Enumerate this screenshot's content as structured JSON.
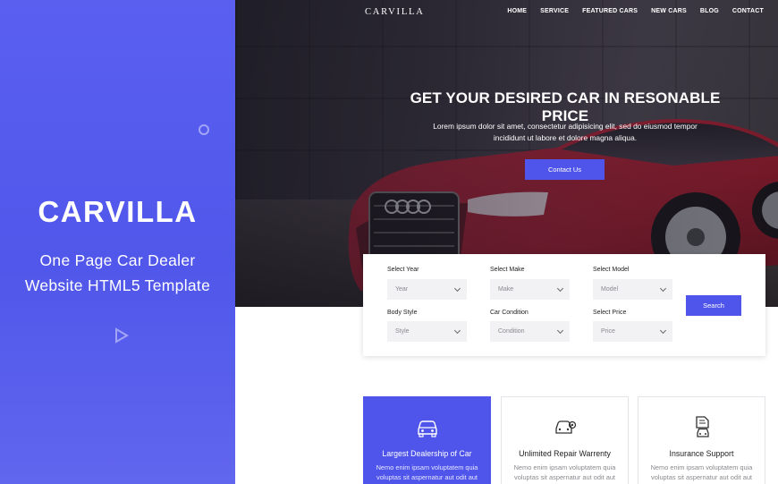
{
  "promo": {
    "title": "CARVILLA",
    "subtitle_line1": "One Page Car Dealer",
    "subtitle_line2": "Website HTML5 Template"
  },
  "nav": {
    "logo": "CARVILLA",
    "items": [
      "HOME",
      "SERVICE",
      "FEATURED CARS",
      "NEW CARS",
      "BLOG",
      "CONTACT"
    ]
  },
  "hero": {
    "headline": "GET YOUR DESIRED CAR IN RESONABLE PRICE",
    "lead_line1": "Lorem ipsum dolor sit amet, consectetur adipisicing elit, sed do eiusmod tempor",
    "lead_line2": "incididunt ut labore et dolore   magna aliqua.",
    "cta_label": "Contact Us"
  },
  "search": {
    "fields": [
      {
        "label": "Select Year",
        "value": "Year"
      },
      {
        "label": "Select Make",
        "value": "Make"
      },
      {
        "label": "Select Model",
        "value": "Model"
      },
      {
        "label": "Body Style",
        "value": "Style"
      },
      {
        "label": "Car Condition",
        "value": "Condition"
      },
      {
        "label": "Select Price",
        "value": "Price"
      }
    ],
    "button_label": "Search"
  },
  "features": [
    {
      "title": "Largest Dealership of Car",
      "text": "Nemo enim ipsam voluptatem quia voluptas sit aspernatur aut odit aut",
      "icon": "car-icon",
      "active": true
    },
    {
      "title": "Unlimited Repair Warrenty",
      "text": "Nemo enim ipsam voluptatem quia voluptas sit aspernatur aut odit aut",
      "icon": "repair-icon",
      "active": false
    },
    {
      "title": "Insurance Support",
      "text": "Nemo enim ipsam voluptatem quia voluptas sit aspernatur aut odit aut",
      "icon": "insurance-icon",
      "active": false
    }
  ],
  "colors": {
    "accent": "#4f55ea",
    "promo_bg": "#5a5ff0"
  }
}
